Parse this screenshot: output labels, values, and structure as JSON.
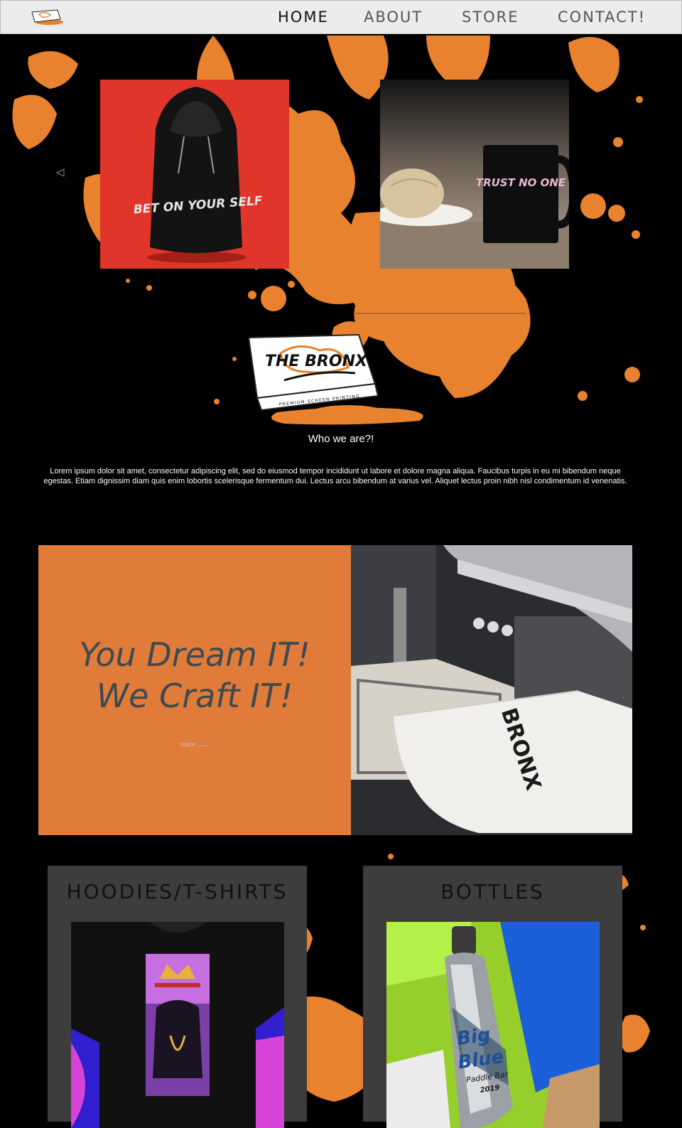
{
  "nav": {
    "items": [
      {
        "label": "HOME",
        "active": true
      },
      {
        "label": "ABOUT",
        "active": false
      },
      {
        "label": "STORE",
        "active": false
      },
      {
        "label": "CONTACT!",
        "active": false
      }
    ]
  },
  "gallery": {
    "hoodie_print": "BET ON YOUR SELF",
    "mug_print": "TRUST NO ONE"
  },
  "brand": {
    "logo_text": "THE BRONX",
    "tagline": "PREMIUM SCREEN PRINTING"
  },
  "about": {
    "title": "Who we are?!",
    "body": "Lorem ipsum dolor sit amet, consectetur adipiscing elit, sed do eiusmod tempor incididunt ut labore et dolore magna aliqua. Faucibus turpis in eu mi bibendum neque egestas. Etiam dignissim diam quis enim lobortis scelerisque fermentum dui. Lectus arcu bibendum at varius vel. Aliquet lectus proin nibh nisl condimentum id venenatis."
  },
  "promo": {
    "line1": "You Dream IT!",
    "line2": "We Craft IT!",
    "since": "since ......",
    "shirt_print": "BRONX"
  },
  "categories": [
    {
      "title": "HOODIES/T-SHIRTS"
    },
    {
      "title": "BOTTLES"
    }
  ],
  "bottle_print": {
    "line1": "Big",
    "line2": "Blue",
    "line3": "Paddle Bar",
    "year": "2019"
  },
  "colors": {
    "accent": "#e07b39",
    "background": "#000000",
    "nav_bg": "#ececec",
    "card_bg": "#3d3d3d",
    "hoodie_bg": "#e0352b"
  }
}
